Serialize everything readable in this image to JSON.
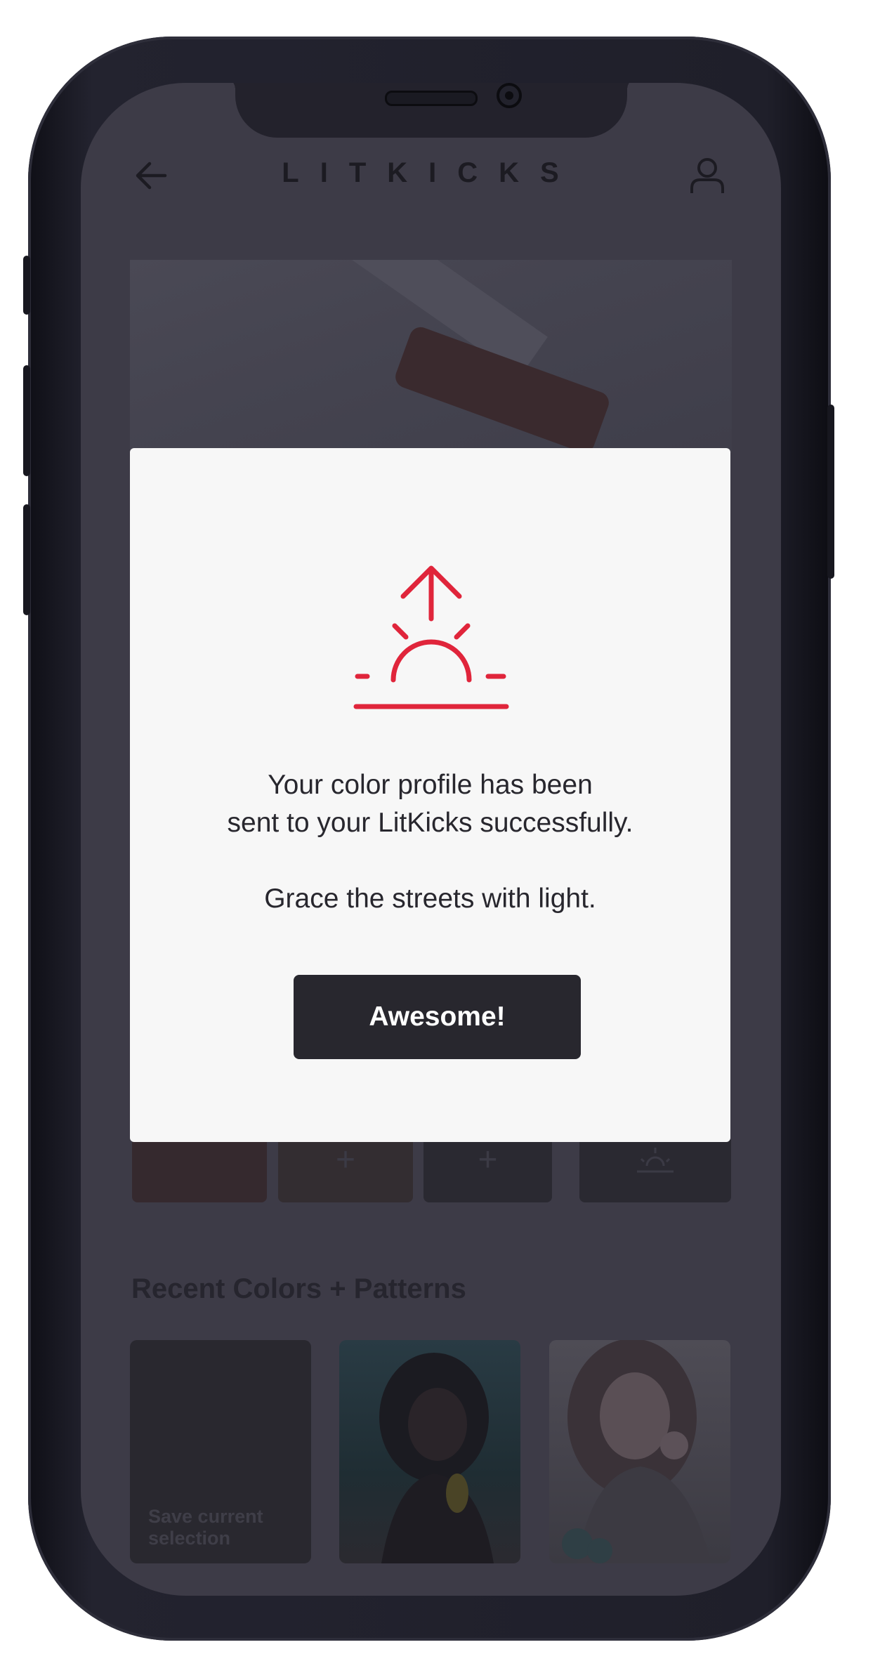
{
  "app": {
    "brand": "LITKICKS",
    "icons": {
      "back": "arrow-left-icon",
      "profile": "user-icon",
      "sunrise": "sunrise-upload-icon",
      "add": "plus-icon"
    },
    "accent_color": "#e0253b"
  },
  "slots": [
    {
      "label": ""
    },
    {
      "label": "+"
    },
    {
      "label": "+"
    },
    {
      "label": ""
    }
  ],
  "recent": {
    "title": "Recent Colors + Patterns",
    "save_card_label": "Save current selection"
  },
  "modal": {
    "message_line1": "Your color profile has been",
    "message_line2": "sent to your LitKicks successfully.",
    "message_line3": "Grace the streets with light.",
    "button_label": "Awesome!"
  }
}
